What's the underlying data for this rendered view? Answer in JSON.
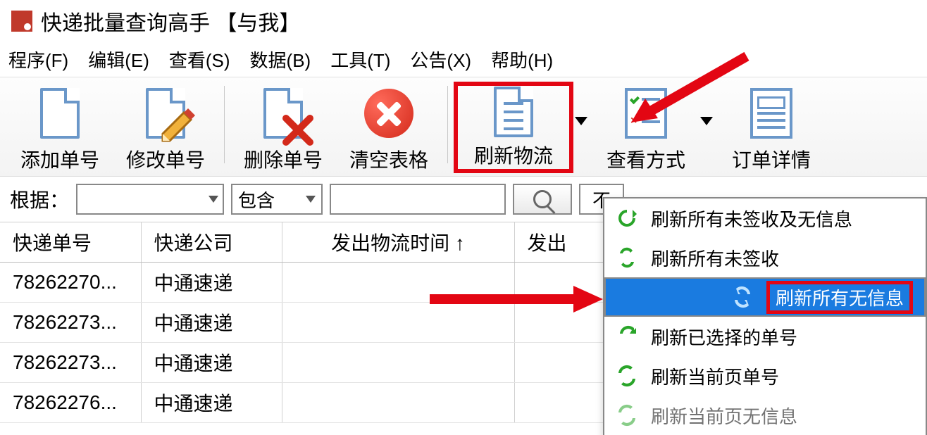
{
  "title": "快递批量查询高手 【与我】",
  "menu": {
    "program": "程序(F)",
    "edit": "编辑(E)",
    "view": "查看(S)",
    "data": "数据(B)",
    "tools": "工具(T)",
    "notice": "公告(X)",
    "help": "帮助(H)"
  },
  "toolbar": {
    "add": "添加单号",
    "edit": "修改单号",
    "delete": "删除单号",
    "clear": "清空表格",
    "refresh": "刷新物流",
    "viewmode": "查看方式",
    "detail": "订单详情"
  },
  "filter": {
    "label": "根据：",
    "op": "包含",
    "value": "",
    "right": "不"
  },
  "columns": {
    "c0": "快递单号",
    "c1": "快递公司",
    "c2": "发出物流时间 ↑",
    "c3": "发出"
  },
  "rows": [
    {
      "no": "78262270...",
      "co": "中通速递"
    },
    {
      "no": "78262273...",
      "co": "中通速递"
    },
    {
      "no": "78262273...",
      "co": "中通速递"
    },
    {
      "no": "78262276...",
      "co": "中通速递"
    }
  ],
  "dropdown": {
    "i0": "刷新所有未签收及无信息",
    "i1": "刷新所有未签收",
    "i2": "刷新所有无信息",
    "i3": "刷新已选择的单号",
    "i4": "刷新当前页单号",
    "i5": "刷新当前页无信息"
  }
}
